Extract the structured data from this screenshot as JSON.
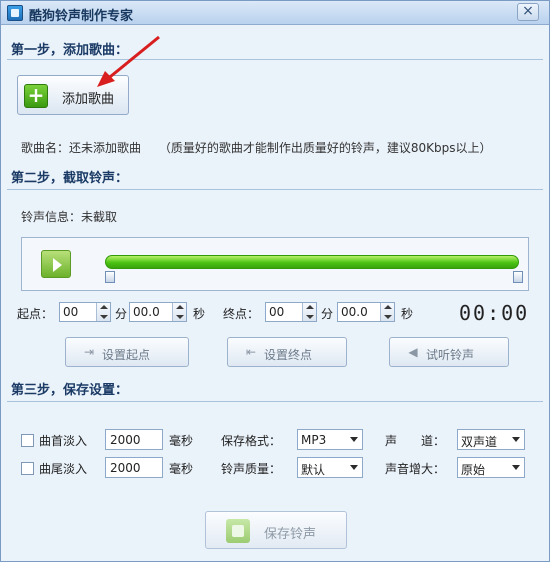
{
  "window": {
    "title": "酷狗铃声制作专家",
    "close_symbol": "×"
  },
  "step1": {
    "heading": "第一步，添加歌曲：",
    "add_button": "添加歌曲",
    "song_name_label": "歌曲名：还未添加歌曲",
    "hint": "（质量好的歌曲才能制作出质量好的铃声，建议80Kbps以上）"
  },
  "step2": {
    "heading": "第二步，截取铃声：",
    "info": "铃声信息：未截取",
    "start_label": "起点：",
    "end_label": "终点：",
    "min_unit": "分",
    "sec_unit": "秒",
    "start_min": "00",
    "start_sec": "00.0",
    "end_min": "00",
    "end_sec": "00.0",
    "timer": "00:00",
    "set_start": "设置起点",
    "set_end": "设置终点",
    "preview": "试听铃声"
  },
  "step3": {
    "heading": "第三步，保存设置：",
    "fade_in": "曲首淡入",
    "fade_out": "曲尾淡入",
    "fade_in_ms": "2000",
    "fade_out_ms": "2000",
    "ms_unit": "毫秒",
    "format_label": "保存格式：",
    "format_value": "MP3",
    "quality_label": "铃声质量：",
    "quality_value": "默认",
    "channel_label": "声　　道：",
    "channel_value": "双声道",
    "volume_label": "声音增大：",
    "volume_value": "原始",
    "save_button": "保存铃声"
  },
  "colors": {
    "accent_green": "#4cc313",
    "arrow_red": "#d81e1e",
    "title_blue": "#17375e"
  }
}
